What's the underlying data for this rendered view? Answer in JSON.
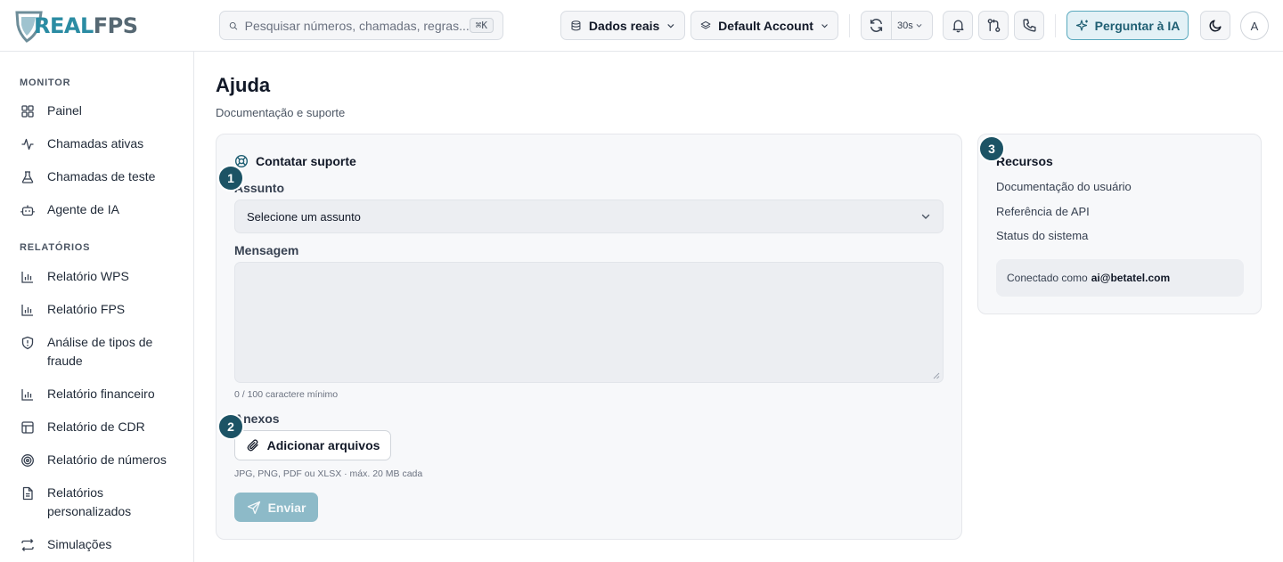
{
  "brand": {
    "part1": "REAL",
    "part2": "FPS"
  },
  "header": {
    "search_placeholder": "Pesquisar números, chamadas, regras...",
    "search_shortcut": "⌘K",
    "data_source": "Dados reais",
    "account": "Default Account",
    "refresh_interval": "30s",
    "ask_ai": "Perguntar à IA",
    "avatar_initial": "A"
  },
  "sidebar": {
    "monitor_label": "MONITOR",
    "monitor_items": [
      "Painel",
      "Chamadas ativas",
      "Chamadas de teste",
      "Agente de IA"
    ],
    "reports_label": "RELATÓRIOS",
    "report_items": [
      "Relatório WPS",
      "Relatório FPS",
      "Análise de tipos de fraude",
      "Relatório financeiro",
      "Relatório de CDR",
      "Relatório de números",
      "Relatórios personalizados",
      "Simulações"
    ]
  },
  "page": {
    "title": "Ajuda",
    "subtitle": "Documentação e suporte"
  },
  "support": {
    "title": "Contatar suporte",
    "subject_label": "Assunto",
    "subject_value": "Selecione um assunto",
    "message_label": "Mensagem",
    "message_hint": "0 / 100 caractere mínimo",
    "attachments_label": "Anexos",
    "add_files": "Adicionar arquivos",
    "files_hint": "JPG, PNG, PDF ou XLSX · máx. 20 MB cada",
    "send": "Enviar"
  },
  "resources": {
    "title": "Recursos",
    "links": [
      "Documentação do usuário",
      "Referência de API",
      "Status do sistema"
    ],
    "connected_prefix": "Conectado como",
    "connected_email": "ai@betatel.com"
  },
  "badges": [
    "1",
    "2",
    "3"
  ],
  "colors": {
    "brand_teal": "#2b8ca3",
    "badge": "#1c5365",
    "ai_button_bg": "#e3f1f6",
    "send_button": "#8dbac8"
  }
}
